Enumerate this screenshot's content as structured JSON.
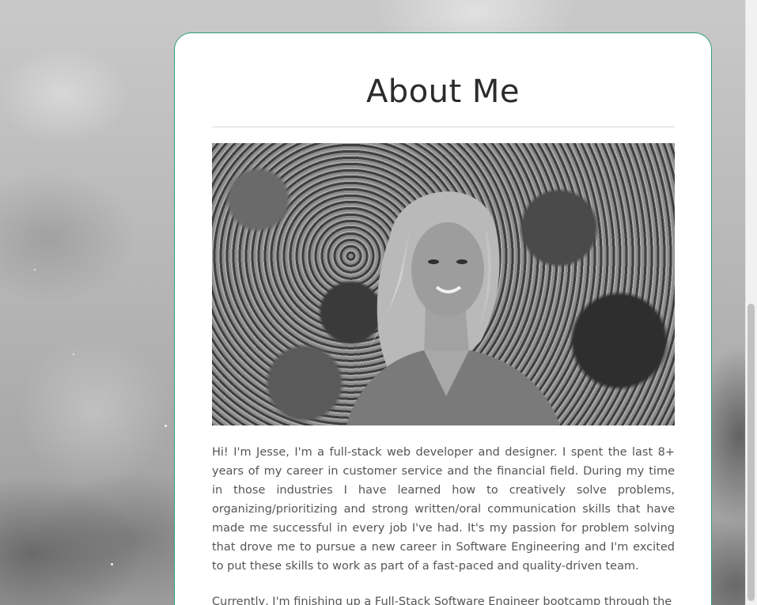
{
  "about": {
    "title": "About Me",
    "photo_alt": "Portrait of Jesse",
    "paragraphs": [
      "Hi! I'm Jesse, I'm a full-stack web developer and designer. I spent the last 8+ years of my career in customer service and the financial field. During my time in those industries I have learned how to creatively solve problems, organizing/prioritizing and strong written/oral communication skills that have made me successful in every job I've had. It's my passion for problem solving that drove me to pursue a new career in Software Engineering and I'm excited to put these skills to work as part of a fast-paced and quality-driven team.",
      "Currently, I'm finishing up a Full-Stack Software Engineer bootcamp through the"
    ]
  },
  "colors": {
    "card_border": "#2f9e7a",
    "title": "#2b2b2b",
    "body_text": "#555555"
  }
}
